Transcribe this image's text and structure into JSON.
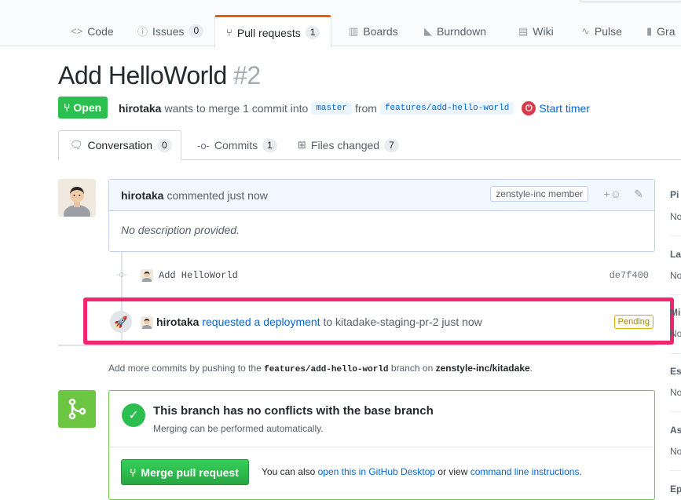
{
  "nav": {
    "tabs": [
      {
        "icon": "<>",
        "label": "Code",
        "count": null
      },
      {
        "icon": "ⓘ",
        "label": "Issues",
        "count": "0"
      },
      {
        "icon": "⑂",
        "label": "Pull requests",
        "count": "1"
      },
      {
        "icon": "▥",
        "label": "Boards",
        "count": null
      },
      {
        "icon": "◣",
        "label": "Burndown",
        "count": null
      },
      {
        "icon": "▤",
        "label": "Wiki",
        "count": null
      },
      {
        "icon": "∿",
        "label": "Pulse",
        "count": null
      },
      {
        "icon": "▮",
        "label": "Gra",
        "count": null
      }
    ],
    "selected": "Pull requests"
  },
  "pr": {
    "title": "Add HelloWorld",
    "number": "#2",
    "state": "Open",
    "author": "hirotaka",
    "merge_text_1": "wants to merge 1 commit into",
    "base_branch": "master",
    "merge_text_2": "from",
    "head_branch": "features/add-hello-world",
    "timer": "Start timer"
  },
  "subtabs": [
    {
      "icon": "conversation-icon",
      "label": "Conversation",
      "count": "0"
    },
    {
      "icon": "commit-icon",
      "label": "Commits",
      "count": "1"
    },
    {
      "icon": "diff-icon",
      "label": "Files changed",
      "count": "7"
    }
  ],
  "comment": {
    "author": "hirotaka",
    "action": "commented just now",
    "badge": "zenstyle-inc member",
    "body": "No description provided."
  },
  "commit": {
    "message": "Add HelloWorld",
    "sha": "de7f400"
  },
  "deployment": {
    "author": "hirotaka",
    "link": "requested a deployment",
    "to_text": "to kitadake-staging-pr-2 just now",
    "status": "Pending"
  },
  "add_more": {
    "prefix": "Add more commits by pushing to the",
    "branch": "features/add-hello-world",
    "middle": "branch on",
    "repo": "zenstyle-inc/kitadake",
    "suffix": "."
  },
  "merge": {
    "heading": "This branch has no conflicts with the base branch",
    "subtext": "Merging can be performed automatically.",
    "button": "Merge pull request",
    "also_prefix": "You can also",
    "desktop_link": "open this in GitHub Desktop",
    "also_middle": "or view",
    "cli_link": "command line instructions",
    "also_suffix": "."
  },
  "sidebar": {
    "headings": [
      "Pi",
      "La",
      "Mi",
      "Es",
      "As",
      "Ep"
    ],
    "values": [
      "No",
      "No",
      "No",
      "No",
      "No"
    ]
  },
  "colors": {
    "open_green": "#2cbe4e",
    "highlight_pink": "#f0266f",
    "link_blue": "#0366d6",
    "merge_green": "#6cc644"
  }
}
